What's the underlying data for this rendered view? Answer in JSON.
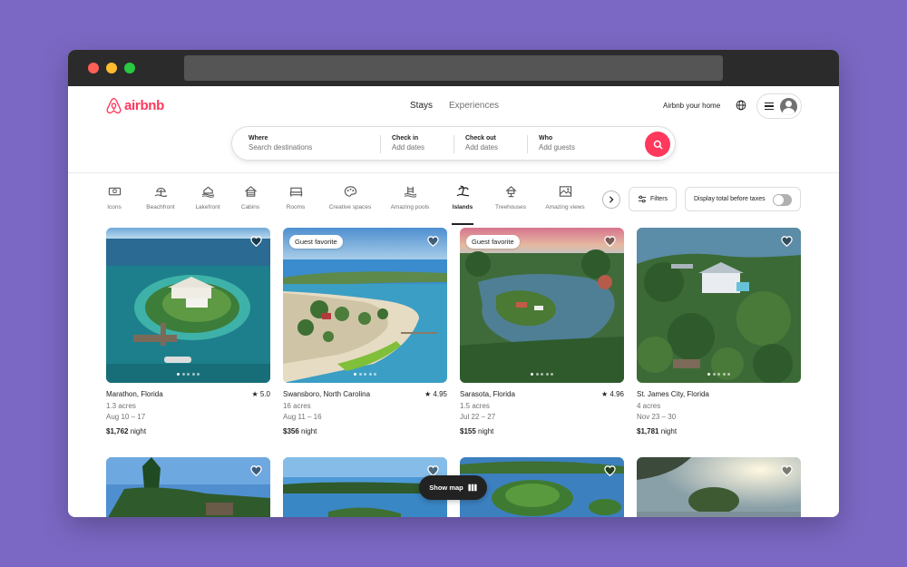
{
  "brand": {
    "name": "airbnb",
    "color": "#ff385c"
  },
  "nav": {
    "tabs": [
      {
        "label": "Stays",
        "active": true
      },
      {
        "label": "Experiences",
        "active": false
      }
    ]
  },
  "header": {
    "host_link": "Airbnb your home",
    "globe_icon": "globe-icon",
    "menu_icon": "hamburger-icon",
    "avatar_icon": "user-avatar-icon"
  },
  "search": {
    "where": {
      "label": "Where",
      "placeholder": "Search destinations"
    },
    "checkin": {
      "label": "Check in",
      "placeholder": "Add dates"
    },
    "checkout": {
      "label": "Check out",
      "placeholder": "Add dates"
    },
    "who": {
      "label": "Who",
      "placeholder": "Add guests"
    }
  },
  "categories": [
    {
      "label": "Icons",
      "icon": "ticket-icon"
    },
    {
      "label": "Beachfront",
      "icon": "beach-icon"
    },
    {
      "label": "Lakefront",
      "icon": "lake-icon"
    },
    {
      "label": "Cabins",
      "icon": "cabin-icon"
    },
    {
      "label": "Rooms",
      "icon": "bed-icon"
    },
    {
      "label": "Creative spaces",
      "icon": "palette-icon"
    },
    {
      "label": "Amazing pools",
      "icon": "pool-icon"
    },
    {
      "label": "Islands",
      "icon": "island-icon",
      "active": true
    },
    {
      "label": "Treehouses",
      "icon": "treehouse-icon"
    },
    {
      "label": "Amazing views",
      "icon": "view-icon"
    }
  ],
  "filters": {
    "label": "Filters",
    "taxes_label": "Display total before taxes",
    "taxes_on": false
  },
  "listings": [
    {
      "location": "Marathon, Florida",
      "rating": "5.0",
      "line1": "1.3 acres",
      "line2": "Aug 10 – 17",
      "price": "$1,762",
      "price_unit": "night",
      "badge": ""
    },
    {
      "location": "Swansboro, North Carolina",
      "rating": "4.95",
      "line1": "16 acres",
      "line2": "Aug 11 – 16",
      "price": "$356",
      "price_unit": "night",
      "badge": "Guest favorite"
    },
    {
      "location": "Sarasota, Florida",
      "rating": "4.96",
      "line1": "1.5 acres",
      "line2": "Jul 22 – 27",
      "price": "$155",
      "price_unit": "night",
      "badge": "Guest favorite"
    },
    {
      "location": "St. James City, Florida",
      "rating": "",
      "line1": "4 acres",
      "line2": "Nov 23 – 30",
      "price": "$1,781",
      "price_unit": "night",
      "badge": ""
    }
  ],
  "show_map": {
    "label": "Show map"
  },
  "colors": {
    "background": "#7b68c4",
    "accent": "#ff385c",
    "text": "#222222",
    "muted": "#717171"
  }
}
